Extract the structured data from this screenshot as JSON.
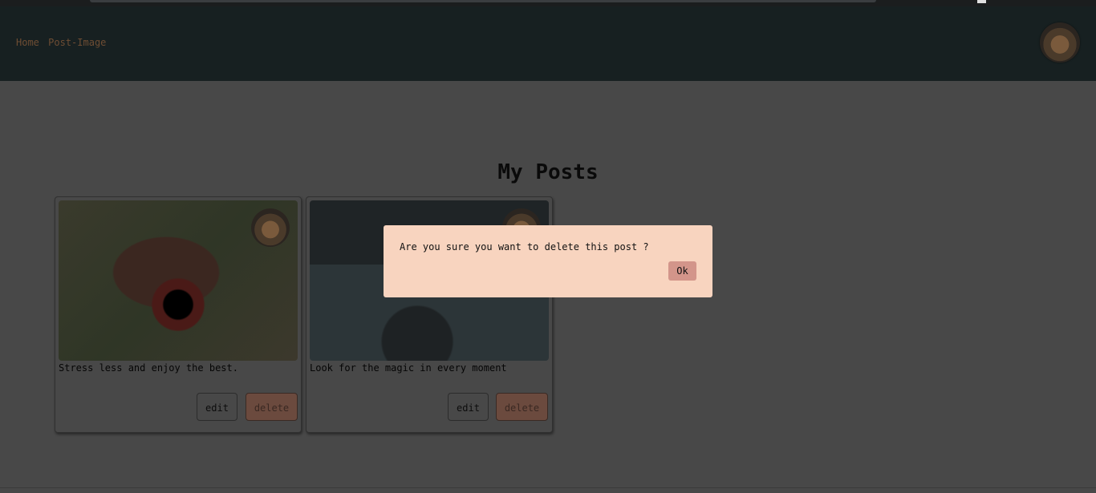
{
  "nav": {
    "home": "Home",
    "post_image": "Post-Image"
  },
  "page_title": "My Posts",
  "posts": [
    {
      "caption": "Stress less and enjoy the best.",
      "edit_label": "edit",
      "delete_label": "delete"
    },
    {
      "caption": "Look for the magic in every moment",
      "edit_label": "edit",
      "delete_label": "delete"
    }
  ],
  "dialog": {
    "message": "Are you sure you want to delete this post ?",
    "ok_label": "Ok"
  },
  "colors": {
    "header_bg": "#172021",
    "overlay_bg": "#484848",
    "dialog_bg": "#f8d4bf",
    "ok_button": "#d3958a",
    "delete_button": "#6b4a3e"
  }
}
